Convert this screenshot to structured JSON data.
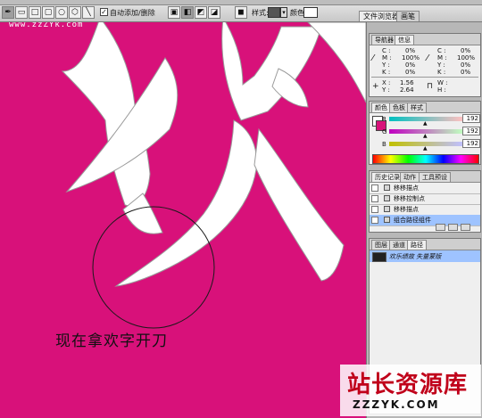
{
  "watermark_top": "www.zzZYk.com",
  "toolbar": {
    "auto_add_label": "自动添加/删除",
    "auto_add_checked": "✓",
    "style_label": "样式:",
    "color_label": "颜色:",
    "tab_file_browser": "文件浏览器",
    "tab_brush": "画笔"
  },
  "panels": {
    "nav_tabs": [
      "导航器",
      "信息"
    ],
    "info": {
      "c_label": "C :",
      "c_val": "0%",
      "m_label": "M :",
      "m_val": "100%",
      "y_label": "Y :",
      "y_val": "0%",
      "k_label": "K :",
      "k_val": "0%",
      "c2_label": "C :",
      "c2_val": "0%",
      "m2_label": "M :",
      "m2_val": "100%",
      "y2_label": "Y :",
      "y2_val": "0%",
      "k2_label": "K :",
      "k2_val": "0%",
      "x_label": "X :",
      "x_val": "1.56",
      "y3_label": "Y :",
      "y3_val": "2.64",
      "w_label": "W :",
      "h_label": "H :"
    },
    "color_tabs": [
      "颜色",
      "色板",
      "样式"
    ],
    "color": {
      "r_label": "R",
      "r_val": "192",
      "g_label": "G",
      "g_val": "192",
      "b_label": "B",
      "b_val": "192"
    },
    "history_tabs": [
      "历史记录",
      "动作",
      "工具预设"
    ],
    "history": [
      "移移描点",
      "移移控制点",
      "移移描点",
      "组合路径组件"
    ],
    "paths_tabs": [
      "图层",
      "通道",
      "路径"
    ],
    "path_item": "欢乐绩故 失量蒙版"
  },
  "canvas": {
    "caption": "现在拿欢字开刀"
  },
  "colors": {
    "canvas_bg": "#d8117a",
    "glyph": "#ffffff",
    "selected_row": "#9ec3ff"
  },
  "logo": {
    "main": "站长资源库",
    "sub": "ZZZYK.COM"
  }
}
